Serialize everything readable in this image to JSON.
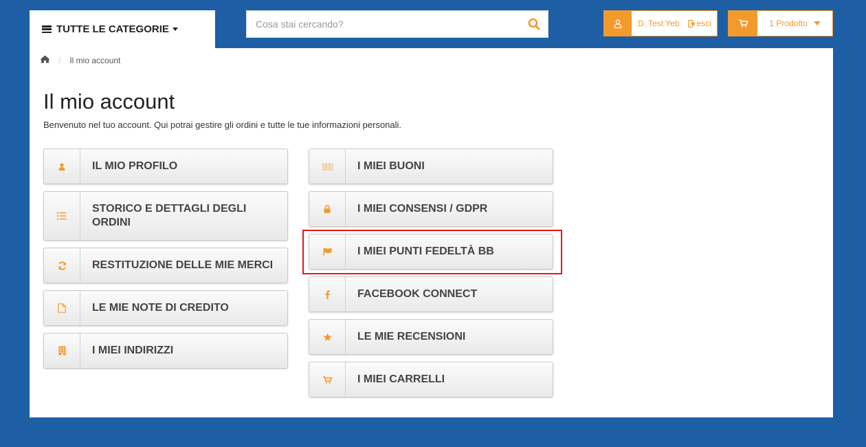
{
  "header": {
    "categories_label": "TUTTE LE CATEGORIE",
    "search_placeholder": "Cosa stai cercando?",
    "user_name": "D. Test Yeb",
    "logout_label": "esci",
    "cart_label": "1 Prodotto"
  },
  "breadcrumb": {
    "home_icon": "home-icon",
    "separator": "/",
    "current": "Il mio account"
  },
  "page": {
    "title": "Il mio account",
    "intro": "Benvenuto nel tuo account. Qui potrai gestire gli ordini e tutte le tue informazioni personali."
  },
  "account_links": {
    "left": [
      {
        "label": "IL MIO PROFILO",
        "icon": "user-icon"
      },
      {
        "label": "STORICO E DETTAGLI DEGLI ORDINI",
        "icon": "list-icon"
      },
      {
        "label": "RESTITUZIONE DELLE MIE MERCI",
        "icon": "refresh-icon"
      },
      {
        "label": "LE MIE NOTE DI CREDITO",
        "icon": "file-icon"
      },
      {
        "label": "I MIEI INDIRIZZI",
        "icon": "building-icon"
      }
    ],
    "right": [
      {
        "label": "I MIEI BUONI",
        "icon": "barcode-icon"
      },
      {
        "label": "I MIEI CONSENSI / GDPR",
        "icon": "lock-icon"
      },
      {
        "label": "I MIEI PUNTI FEDELTÀ BB",
        "icon": "flag-icon"
      },
      {
        "label": "FACEBOOK CONNECT",
        "icon": "facebook-icon"
      },
      {
        "label": "LE MIE RECENSIONI",
        "icon": "star-icon"
      },
      {
        "label": "I MIEI CARRELLI",
        "icon": "cart-icon"
      }
    ]
  },
  "colors": {
    "background": "#1d5ea4",
    "accent": "#f39a2c",
    "highlight": "#e01818"
  }
}
